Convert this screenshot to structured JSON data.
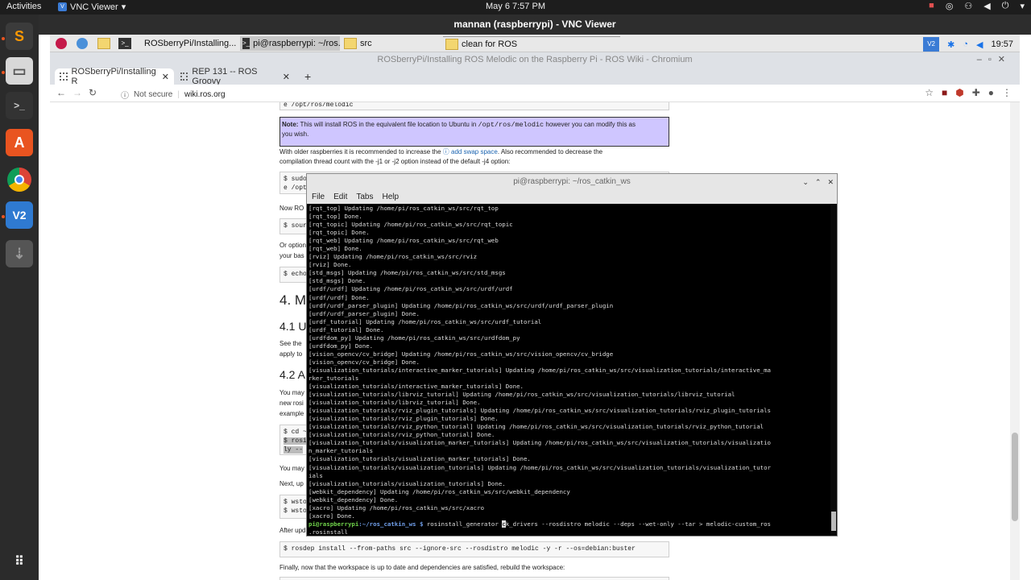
{
  "topbar": {
    "activities": "Activities",
    "app_name": "VNC Viewer",
    "datetime": "May 6   7:57 PM"
  },
  "vnc": {
    "title": "mannan (raspberrypi) - VNC Viewer"
  },
  "pi_taskbar": {
    "tasks": [
      "ROSberryPi/Installing...",
      "pi@raspberrypi: ~/ros...",
      "src",
      "clean for ROS"
    ],
    "time": "19:57"
  },
  "chromium": {
    "window_title": "ROSberryPi/Installing ROS Melodic on the Raspberry Pi - ROS Wiki - Chromium",
    "tabs": [
      "ROSberryPi/Installing R",
      "REP 131 -- ROS Groovy"
    ],
    "new_tab": "+",
    "not_secure": "Not secure",
    "url": "wiki.ros.org"
  },
  "page": {
    "code_top": "e /opt/ros/melodic",
    "note_bold": "Note:",
    "note_text1": " This will install ROS in the equivalent file location to Ubuntu in ",
    "note_mono": "/opt/ros/melodic",
    "note_text2": " however you can modify this as",
    "note_text3": "you wish.",
    "para1a": "With older raspberries it is recommended to increase the ",
    "para1_link": "add swap space",
    "para1b": ". Also recommended to decrease the",
    "para1c": "compilation thread count with the -j1 or -j2 option instead of the default -j4 option:",
    "code2a": "$ sudo",
    "code2b": "e /opt",
    "now_ro": "Now RO",
    "code3": "$ sour",
    "or_option": "Or option",
    "your_bas": "your bas",
    "code4": "$ echo",
    "h2": "4. M",
    "h3a": "4.1 U",
    "see_the": "See the",
    "apply_to": "apply to",
    "h3b": "4.2 A",
    "you_may": "You may",
    "new_rosi": "new rosi",
    "example": "example",
    "code5a": "$ cd ~",
    "code5b": "$ rosi",
    "code5c": "ly --",
    "you_may2": "You may",
    "next_up": "Next, up",
    "code6a": "$ wsto",
    "code6b": "$ wsto",
    "after_upd": "After upd",
    "code7": "$ rosdep install --from-paths src --ignore-src --rosdistro melodic -y -r --os=debian:buster",
    "finally": "Finally, now that the workspace is up to date and dependencies are satisfied, rebuild the workspace:"
  },
  "terminal": {
    "title": "pi@raspberrypi: ~/ros_catkin_ws",
    "menu": [
      "File",
      "Edit",
      "Tabs",
      "Help"
    ],
    "lines": [
      "[rqt_top] Updating /home/pi/ros_catkin_ws/src/rqt_top",
      "[rqt_top] Done.",
      "[rqt_topic] Updating /home/pi/ros_catkin_ws/src/rqt_topic",
      "[rqt_topic] Done.",
      "[rqt_web] Updating /home/pi/ros_catkin_ws/src/rqt_web",
      "[rqt_web] Done.",
      "[rviz] Updating /home/pi/ros_catkin_ws/src/rviz",
      "[rviz] Done.",
      "[std_msgs] Updating /home/pi/ros_catkin_ws/src/std_msgs",
      "[std_msgs] Done.",
      "[urdf/urdf] Updating /home/pi/ros_catkin_ws/src/urdf/urdf",
      "[urdf/urdf] Done.",
      "[urdf/urdf_parser_plugin] Updating /home/pi/ros_catkin_ws/src/urdf/urdf_parser_plugin",
      "[urdf/urdf_parser_plugin] Done.",
      "[urdf_tutorial] Updating /home/pi/ros_catkin_ws/src/urdf_tutorial",
      "[urdf_tutorial] Done.",
      "[urdfdom_py] Updating /home/pi/ros_catkin_ws/src/urdfdom_py",
      "[urdfdom_py] Done.",
      "[vision_opencv/cv_bridge] Updating /home/pi/ros_catkin_ws/src/vision_opencv/cv_bridge",
      "[vision_opencv/cv_bridge] Done.",
      "[visualization_tutorials/interactive_marker_tutorials] Updating /home/pi/ros_catkin_ws/src/visualization_tutorials/interactive_ma",
      "rker_tutorials",
      "[visualization_tutorials/interactive_marker_tutorials] Done.",
      "[visualization_tutorials/librviz_tutorial] Updating /home/pi/ros_catkin_ws/src/visualization_tutorials/librviz_tutorial",
      "[visualization_tutorials/librviz_tutorial] Done.",
      "[visualization_tutorials/rviz_plugin_tutorials] Updating /home/pi/ros_catkin_ws/src/visualization_tutorials/rviz_plugin_tutorials",
      "[visualization_tutorials/rviz_plugin_tutorials] Done.",
      "[visualization_tutorials/rviz_python_tutorial] Updating /home/pi/ros_catkin_ws/src/visualization_tutorials/rviz_python_tutorial",
      "[visualization_tutorials/rviz_python_tutorial] Done.",
      "[visualization_tutorials/visualization_marker_tutorials] Updating /home/pi/ros_catkin_ws/src/visualization_tutorials/visualizatio",
      "n_marker_tutorials",
      "[visualization_tutorials/visualization_marker_tutorials] Done.",
      "[visualization_tutorials/visualization_tutorials] Updating /home/pi/ros_catkin_ws/src/visualization_tutorials/visualization_tutor",
      "ials",
      "[visualization_tutorials/visualization_tutorials] Done.",
      "[webkit_dependency] Updating /home/pi/ros_catkin_ws/src/webkit_dependency",
      "[webkit_dependency] Done.",
      "[xacro] Updating /home/pi/ros_catkin_ws/src/xacro",
      "[xacro] Done."
    ],
    "prompt_user": "pi@raspberrypi",
    "prompt_path": ":~/ros_catkin_ws $",
    "command_a": " rosinstall_generator ",
    "cursor_char": "c",
    "command_b": "k_drivers --rosdistro melodic --deps --wet-only --tar > melodic-custom_ros",
    "command_wrap": ".rosinstall"
  },
  "colors": {
    "note_bg": "#cfc6ff",
    "prompt_user": "#6fd14a",
    "prompt_path": "#6f9de8",
    "ubuntu_accent": "#e95420"
  }
}
